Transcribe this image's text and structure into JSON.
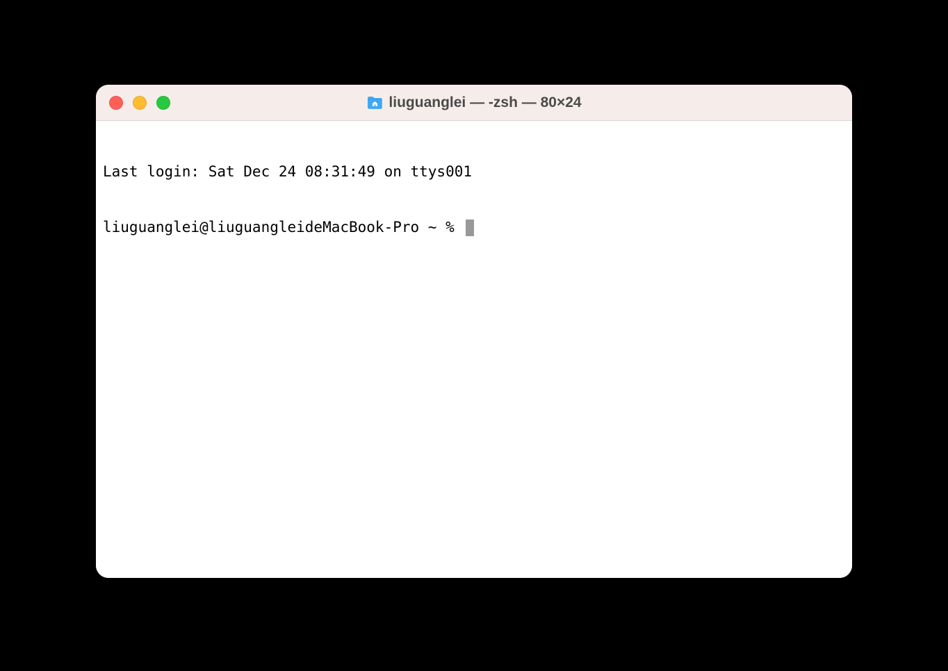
{
  "window": {
    "title": "liuguanglei — -zsh — 80×24"
  },
  "terminal": {
    "last_login_line": "Last login: Sat Dec 24 08:31:49 on ttys001",
    "prompt": "liuguanglei@liuguangleideMacBook-Pro ~ % "
  }
}
